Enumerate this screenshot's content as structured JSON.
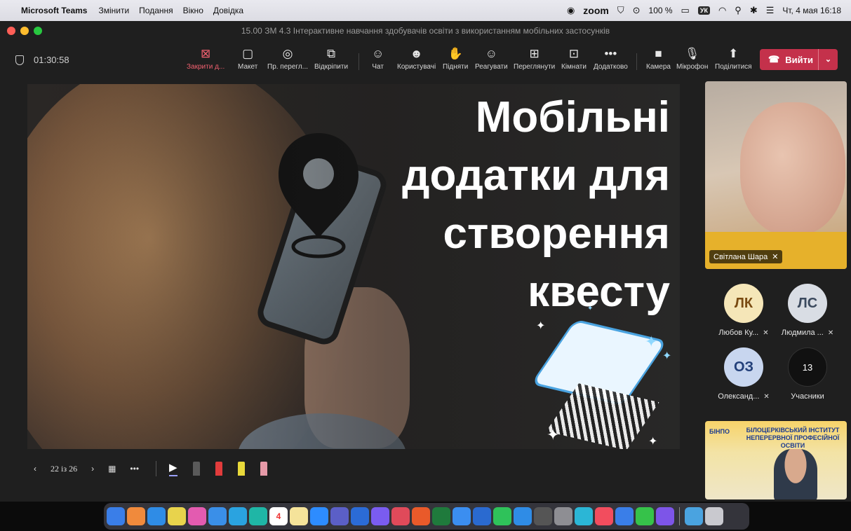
{
  "menubar": {
    "app_name": "Microsoft Teams",
    "menus": [
      "Змінити",
      "Подання",
      "Вікно",
      "Довідка"
    ],
    "zoom_label": "zoom",
    "battery": "100 %",
    "keyboard_layout": "УК",
    "datetime": "Чт, 4 мая 16:18"
  },
  "window": {
    "title": "15.00 ЗМ 4.3 Інтерактивне навчання здобувачів освіти з використанням мобільних застосунків"
  },
  "toolbar": {
    "timer": "01:30:58",
    "buttons": {
      "close": "Закрити д...",
      "layout": "Макет",
      "preview": "Пр. перегл...",
      "popout": "Відкріпити",
      "chat": "Чат",
      "people": "Користувачі",
      "raise": "Підняти",
      "react": "Реагувати",
      "view": "Переглянути",
      "rooms": "Кімнати",
      "more": "Додатково",
      "camera": "Камера",
      "mic": "Мікрофон",
      "share": "Поділитися"
    },
    "leave_label": "Вийти"
  },
  "slide": {
    "title_lines": [
      "Мобільні",
      "додатки для",
      "створення",
      "квесту"
    ]
  },
  "participants": {
    "main_speaker": "Світлана Шара",
    "list": [
      {
        "initials": "ЛК",
        "name": "Любов Ку...",
        "bg": "#f5e6b8",
        "fg": "#7a4b12"
      },
      {
        "initials": "ЛС",
        "name": "Людмила ...",
        "bg": "#d9dde4",
        "fg": "#3c4a5e"
      },
      {
        "initials": "ОЗ",
        "name": "Олександ...",
        "bg": "#c8d6ef",
        "fg": "#23407a"
      }
    ],
    "others_count": "13",
    "others_label": "Учасники"
  },
  "video_tile": {
    "logo": "БІНПО",
    "banner_lines": [
      "БІЛОЦЕРКІВСЬКИЙ ІНСТИТУТ",
      "НЕПЕРЕРВНОЇ ПРОФЕСІЙНОЇ ОСВІТИ"
    ]
  },
  "presenter": {
    "page_indicator": "22 із 26"
  },
  "dock": {
    "calendar_day": "4"
  }
}
